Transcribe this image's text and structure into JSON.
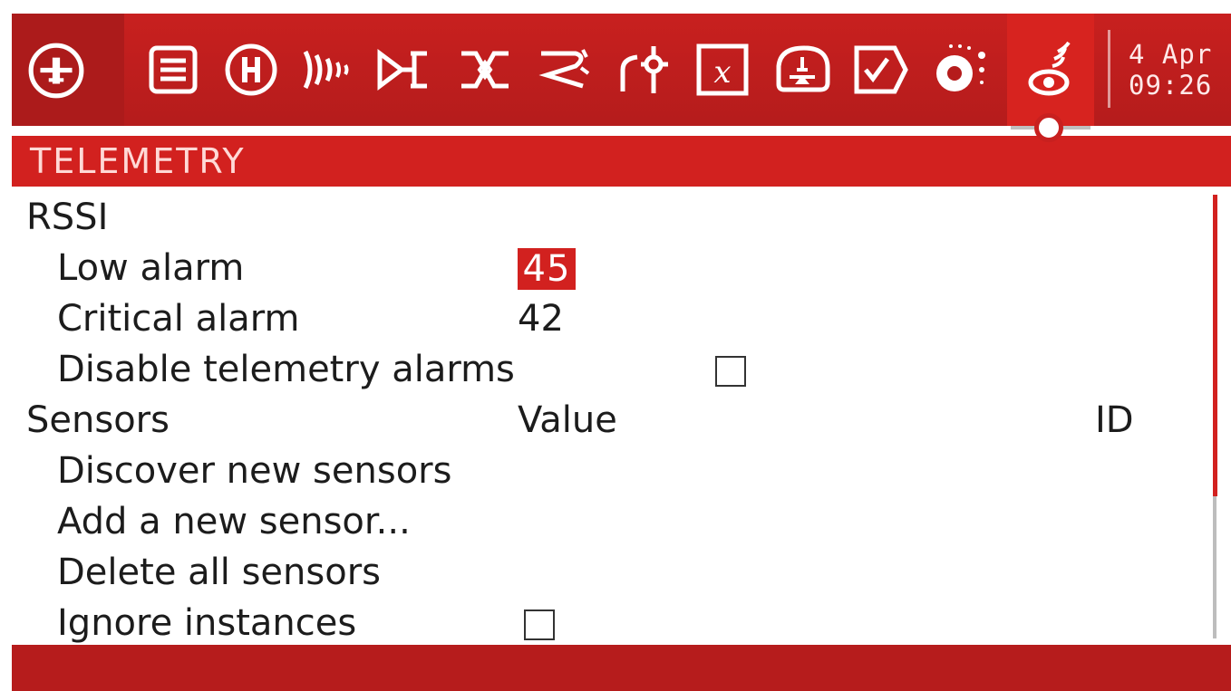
{
  "header": {
    "tabs": [
      {
        "icon": "plane-icon"
      },
      {
        "icon": "list-icon"
      },
      {
        "icon": "heli-icon"
      },
      {
        "icon": "signal-icon"
      },
      {
        "icon": "flight-mode-icon"
      },
      {
        "icon": "mixer-icon"
      },
      {
        "icon": "curve-icon"
      },
      {
        "icon": "logic-switch-icon"
      },
      {
        "icon": "special-function-icon"
      },
      {
        "icon": "throttle-icon"
      },
      {
        "icon": "checklist-icon"
      },
      {
        "icon": "display-icon"
      },
      {
        "icon": "telemetry-icon",
        "active": true
      }
    ],
    "date": "4 Apr",
    "time": "09:26"
  },
  "page": {
    "title": "TELEMETRY"
  },
  "rssi": {
    "section_label": "RSSI",
    "low_alarm_label": "Low alarm",
    "low_alarm_value": "45",
    "critical_alarm_label": "Critical alarm",
    "critical_alarm_value": "42",
    "disable_alarms_label": "Disable telemetry alarms",
    "disable_alarms_checked": false
  },
  "sensors": {
    "section_label": "Sensors",
    "value_header": "Value",
    "id_header": "ID",
    "discover_label": "Discover new sensors",
    "add_label": "Add a new sensor...",
    "delete_label": "Delete all sensors",
    "ignore_instances_label": "Ignore instances",
    "ignore_instances_checked": false
  },
  "colors": {
    "accent": "#d2211f",
    "header_bg": "#c8201f",
    "footer_bg": "#b61c1c"
  }
}
